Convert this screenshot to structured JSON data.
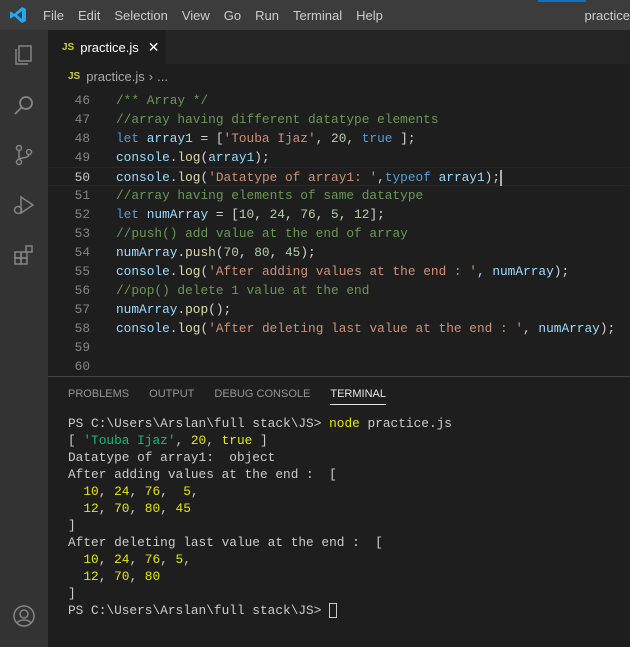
{
  "menu": {
    "items": [
      "File",
      "Edit",
      "Selection",
      "View",
      "Go",
      "Run",
      "Terminal",
      "Help"
    ],
    "title": "practice"
  },
  "tab": {
    "icon": "JS",
    "label": "practice.js",
    "close": "✕"
  },
  "breadcrumb": {
    "file": "practice.js",
    "sep": "›",
    "rest": "..."
  },
  "editor": {
    "lines": [
      {
        "num": "46",
        "tokens": [
          [
            "/** Array */",
            "c"
          ]
        ]
      },
      {
        "num": "47",
        "tokens": [
          [
            "//array having different datatype elements",
            "c"
          ]
        ]
      },
      {
        "num": "48",
        "tokens": [
          [
            "let ",
            "k"
          ],
          [
            "array1",
            "v"
          ],
          [
            " = [",
            "p"
          ],
          [
            "'Touba Ijaz'",
            "s"
          ],
          [
            ", ",
            "p"
          ],
          [
            "20",
            "n"
          ],
          [
            ", ",
            "p"
          ],
          [
            "true",
            "k"
          ],
          [
            " ];",
            "p"
          ]
        ]
      },
      {
        "num": "49",
        "tokens": [
          [
            "console",
            "v"
          ],
          [
            ".",
            "p"
          ],
          [
            "log",
            "f"
          ],
          [
            "(",
            "p"
          ],
          [
            "array1",
            "v"
          ],
          [
            ");",
            "p"
          ]
        ]
      },
      {
        "num": "50",
        "current": true,
        "tokens": [
          [
            "console",
            "v"
          ],
          [
            ".",
            "p"
          ],
          [
            "log",
            "f"
          ],
          [
            "(",
            "p"
          ],
          [
            "'Datatype of array1: '",
            "s"
          ],
          [
            ",",
            "p"
          ],
          [
            "typeof ",
            "k"
          ],
          [
            "array1",
            "v"
          ],
          [
            ");",
            "p"
          ]
        ]
      },
      {
        "num": "51",
        "tokens": [
          [
            "//array having elements of same datatype",
            "c"
          ]
        ]
      },
      {
        "num": "52",
        "tokens": [
          [
            "let ",
            "k"
          ],
          [
            "numArray",
            "v"
          ],
          [
            " = [",
            "p"
          ],
          [
            "10",
            "n"
          ],
          [
            ", ",
            "p"
          ],
          [
            "24",
            "n"
          ],
          [
            ", ",
            "p"
          ],
          [
            "76",
            "n"
          ],
          [
            ", ",
            "p"
          ],
          [
            "5",
            "n"
          ],
          [
            ", ",
            "p"
          ],
          [
            "12",
            "n"
          ],
          [
            "];",
            "p"
          ]
        ]
      },
      {
        "num": "53",
        "tokens": [
          [
            "//push() add value at the end of array",
            "c"
          ]
        ]
      },
      {
        "num": "54",
        "tokens": [
          [
            "numArray",
            "v"
          ],
          [
            ".",
            "p"
          ],
          [
            "push",
            "f"
          ],
          [
            "(",
            "p"
          ],
          [
            "70",
            "n"
          ],
          [
            ", ",
            "p"
          ],
          [
            "80",
            "n"
          ],
          [
            ", ",
            "p"
          ],
          [
            "45",
            "n"
          ],
          [
            ");",
            "p"
          ]
        ]
      },
      {
        "num": "55",
        "tokens": [
          [
            "console",
            "v"
          ],
          [
            ".",
            "p"
          ],
          [
            "log",
            "f"
          ],
          [
            "(",
            "p"
          ],
          [
            "'After adding values at the end : '",
            "s"
          ],
          [
            ", ",
            "p"
          ],
          [
            "numArray",
            "v"
          ],
          [
            ");",
            "p"
          ]
        ]
      },
      {
        "num": "56",
        "tokens": [
          [
            "//pop() delete 1 value at the end",
            "c"
          ]
        ]
      },
      {
        "num": "57",
        "tokens": [
          [
            "numArray",
            "v"
          ],
          [
            ".",
            "p"
          ],
          [
            "pop",
            "f"
          ],
          [
            "();",
            "p"
          ]
        ]
      },
      {
        "num": "58",
        "tokens": [
          [
            "console",
            "v"
          ],
          [
            ".",
            "p"
          ],
          [
            "log",
            "f"
          ],
          [
            "(",
            "p"
          ],
          [
            "'After deleting last value at the end : '",
            "s"
          ],
          [
            ", ",
            "p"
          ],
          [
            "numArray",
            "v"
          ],
          [
            ");",
            "p"
          ]
        ]
      },
      {
        "num": "59",
        "tokens": []
      },
      {
        "num": "60",
        "tokens": []
      }
    ]
  },
  "panel": {
    "tabs": [
      "PROBLEMS",
      "OUTPUT",
      "DEBUG CONSOLE",
      "TERMINAL"
    ],
    "active": 3
  },
  "terminal": {
    "lines": [
      [
        [
          "PS C:\\Users\\Arslan\\full stack\\JS> ",
          "w"
        ],
        [
          "node",
          "y"
        ],
        [
          " practice.js",
          "w"
        ]
      ],
      [
        [
          "[ ",
          "w"
        ],
        [
          "'Touba Ijaz'",
          "g"
        ],
        [
          ", ",
          "w"
        ],
        [
          "20",
          "y"
        ],
        [
          ", ",
          "w"
        ],
        [
          "true",
          "y"
        ],
        [
          " ]",
          "w"
        ]
      ],
      [
        [
          "Datatype of array1:  object",
          "w"
        ]
      ],
      [
        [
          "After adding values at the end :  [",
          "w"
        ]
      ],
      [
        [
          "  ",
          "w"
        ],
        [
          "10",
          "y"
        ],
        [
          ", ",
          "w"
        ],
        [
          "24",
          "y"
        ],
        [
          ", ",
          "w"
        ],
        [
          "76",
          "y"
        ],
        [
          ",  ",
          "w"
        ],
        [
          "5",
          "y"
        ],
        [
          ",",
          "w"
        ]
      ],
      [
        [
          "  ",
          "w"
        ],
        [
          "12",
          "y"
        ],
        [
          ", ",
          "w"
        ],
        [
          "70",
          "y"
        ],
        [
          ", ",
          "w"
        ],
        [
          "80",
          "y"
        ],
        [
          ", ",
          "w"
        ],
        [
          "45",
          "y"
        ]
      ],
      [
        [
          "]",
          "w"
        ]
      ],
      [
        [
          "After deleting last value at the end :  [",
          "w"
        ]
      ],
      [
        [
          "  ",
          "w"
        ],
        [
          "10",
          "y"
        ],
        [
          ", ",
          "w"
        ],
        [
          "24",
          "y"
        ],
        [
          ", ",
          "w"
        ],
        [
          "76",
          "y"
        ],
        [
          ", ",
          "w"
        ],
        [
          "5",
          "y"
        ],
        [
          ",",
          "w"
        ]
      ],
      [
        [
          "  ",
          "w"
        ],
        [
          "12",
          "y"
        ],
        [
          ", ",
          "w"
        ],
        [
          "70",
          "y"
        ],
        [
          ", ",
          "w"
        ],
        [
          "80",
          "y"
        ]
      ],
      [
        [
          "]",
          "w"
        ]
      ],
      [
        [
          "PS C:\\Users\\Arslan\\full stack\\JS> ",
          "w"
        ]
      ]
    ]
  }
}
